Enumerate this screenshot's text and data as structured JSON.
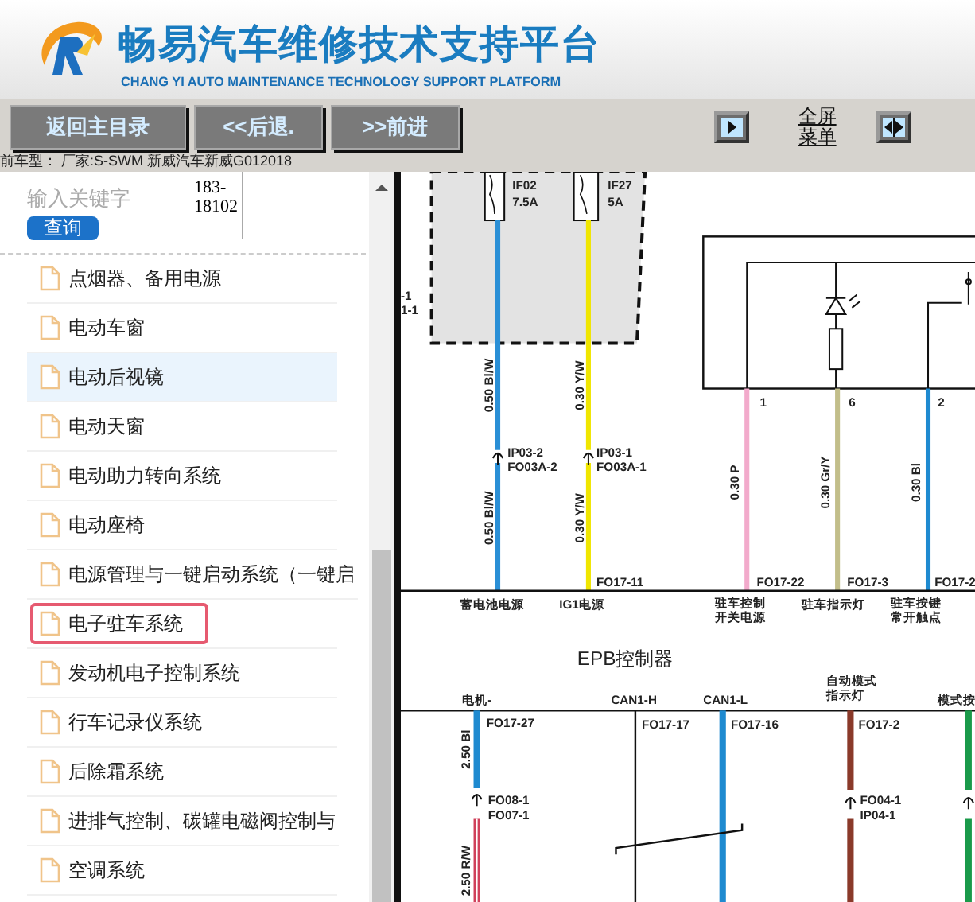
{
  "header": {
    "title": "畅易汽车维修技术支持平台",
    "subtitle": "CHANG YI AUTO MAINTENANCE TECHNOLOGY SUPPORT PLATFORM"
  },
  "toolbar": {
    "buttons": [
      "返回主目录",
      "<<后退.",
      ">>前进"
    ],
    "fullscreen_menu": "全屏菜单"
  },
  "vehicle_info": "前车型：  厂家:S-SWM 新威汽车新威G012018",
  "search": {
    "placeholder": "输入关键字",
    "code": "183-\n18102",
    "button": "查询"
  },
  "menu": [
    {
      "label": "点烟器、备用电源",
      "highlighted": false,
      "boxed": false
    },
    {
      "label": "电动车窗",
      "highlighted": false,
      "boxed": false
    },
    {
      "label": "电动后视镜",
      "highlighted": true,
      "boxed": false
    },
    {
      "label": "电动天窗",
      "highlighted": false,
      "boxed": false
    },
    {
      "label": "电动助力转向系统",
      "highlighted": false,
      "boxed": false
    },
    {
      "label": "电动座椅",
      "highlighted": false,
      "boxed": false
    },
    {
      "label": "电源管理与一键启动系统（一键启",
      "highlighted": false,
      "boxed": false
    },
    {
      "label": "电子驻车系统",
      "highlighted": false,
      "boxed": true
    },
    {
      "label": "发动机电子控制系统",
      "highlighted": false,
      "boxed": false
    },
    {
      "label": "行车记录仪系统",
      "highlighted": false,
      "boxed": false
    },
    {
      "label": "后除霜系统",
      "highlighted": false,
      "boxed": false
    },
    {
      "label": "进排气控制、碳罐电磁阀控制与",
      "highlighted": false,
      "boxed": false
    },
    {
      "label": "空调系统",
      "highlighted": false,
      "boxed": false
    }
  ],
  "diagram": {
    "labels": [
      "IF02",
      "7.5A",
      "IF27",
      "5A",
      "-1",
      "1-1",
      "0.50 Bl/W",
      "0.30 Y/W",
      "IP03-2",
      "FO03A-2",
      "IP03-1",
      "FO03A-1",
      "0.50 Bl/W",
      "0.30 Y/W",
      "FO17-11",
      "1",
      "6",
      "2",
      "0.30 P",
      "0.30 Gr/Y",
      "0.30 Bl",
      "FO17-22",
      "FO17-3",
      "FO17-2",
      "蓄电池电源",
      "IG1电源",
      "驻车控制",
      "开关电源",
      "驻车指示灯",
      "驻车按键",
      "常开触点",
      "EPB控制器",
      "电机-",
      "CAN1-H",
      "CAN1-L",
      "自动模式",
      "指示灯",
      "模式按",
      "FO17-27",
      "2.50 Bl",
      "FO17-17",
      "FO17-16",
      "FO17-2",
      "FO08-1",
      "FO07-1",
      "FO04-1",
      "IP04-1",
      "2.50 R/W"
    ]
  }
}
